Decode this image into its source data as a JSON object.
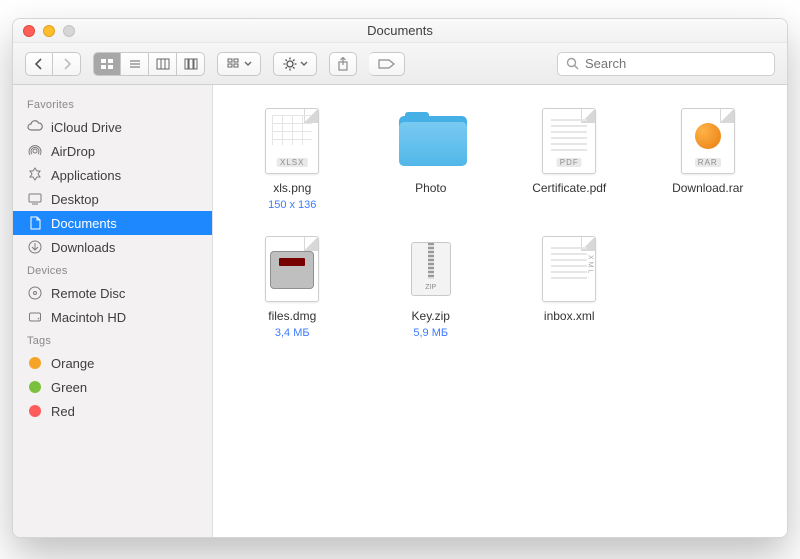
{
  "window": {
    "title": "Documents"
  },
  "toolbar": {
    "search_placeholder": "Search"
  },
  "sidebar": {
    "sections": [
      {
        "title": "Favorites",
        "items": [
          {
            "label": "iCloud Drive",
            "icon": "cloud"
          },
          {
            "label": "AirDrop",
            "icon": "airdrop"
          },
          {
            "label": "Applications",
            "icon": "apps"
          },
          {
            "label": "Desktop",
            "icon": "desktop"
          },
          {
            "label": "Documents",
            "icon": "documents",
            "selected": true
          },
          {
            "label": "Downloads",
            "icon": "downloads"
          }
        ]
      },
      {
        "title": "Devices",
        "items": [
          {
            "label": "Remote Disc",
            "icon": "disc"
          },
          {
            "label": "Macintoh HD",
            "icon": "hdd"
          }
        ]
      },
      {
        "title": "Tags",
        "items": [
          {
            "label": "Orange",
            "color": "#f6a428"
          },
          {
            "label": "Green",
            "color": "#7cc13e"
          },
          {
            "label": "Red",
            "color": "#ff5c5c"
          }
        ]
      }
    ]
  },
  "files": [
    {
      "name": "xls.png",
      "meta": "150 x 136",
      "kind": "xlspng"
    },
    {
      "name": "Photo",
      "meta": "",
      "kind": "folder"
    },
    {
      "name": "Certificate.pdf",
      "meta": "",
      "kind": "pdf"
    },
    {
      "name": "Download.rar",
      "meta": "",
      "kind": "rar"
    },
    {
      "name": "files.dmg",
      "meta": "3,4 МБ",
      "kind": "dmg"
    },
    {
      "name": "Key.zip",
      "meta": "5,9 МБ",
      "kind": "zip"
    },
    {
      "name": "inbox.xml",
      "meta": "",
      "kind": "xml"
    }
  ],
  "badges": {
    "xlspng": "XLSX",
    "pdf": "PDF",
    "rar": "RAR",
    "zip": "ZIP",
    "xml": "XML"
  },
  "tag_colors": {
    "Orange": "#f6a428",
    "Green": "#7cc13e",
    "Red": "#ff5c5c"
  }
}
